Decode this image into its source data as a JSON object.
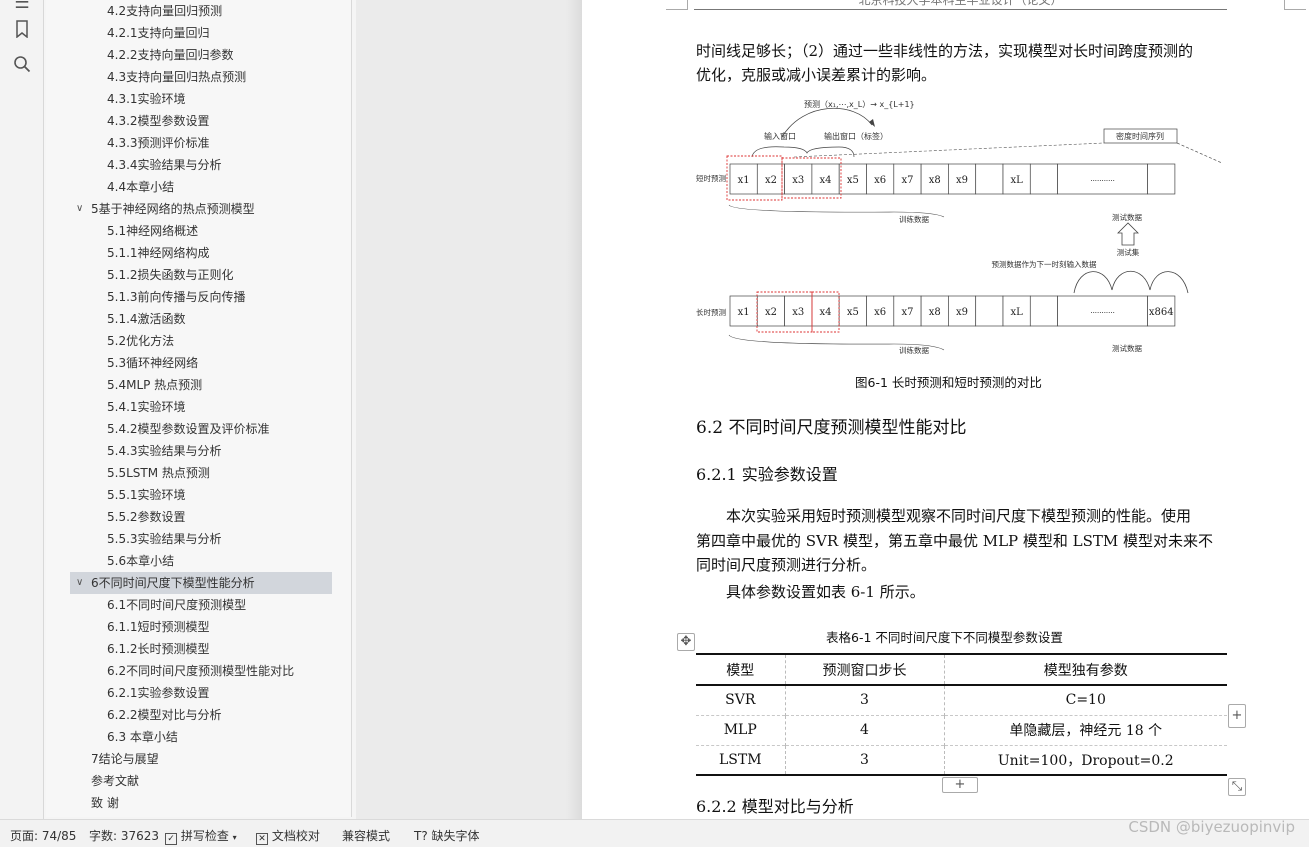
{
  "rail_icons": [
    "list-icon",
    "bookmark-icon",
    "search-icon"
  ],
  "toc": [
    {
      "label": "4.2支持向量回归预测",
      "level": 2
    },
    {
      "label": "4.2.1支持向量回归",
      "level": 2
    },
    {
      "label": "4.2.2支持向量回归参数",
      "level": 2
    },
    {
      "label": "4.3支持向量回归热点预测",
      "level": 2
    },
    {
      "label": "4.3.1实验环境",
      "level": 2
    },
    {
      "label": "4.3.2模型参数设置",
      "level": 2
    },
    {
      "label": "4.3.3预测评价标准",
      "level": 2
    },
    {
      "label": "4.3.4实验结果与分析",
      "level": 2
    },
    {
      "label": "4.4本章小结",
      "level": 2
    },
    {
      "label": "5基于神经网络的热点预测模型",
      "level": 1,
      "expanded": true
    },
    {
      "label": "5.1神经网络概述",
      "level": 2
    },
    {
      "label": "5.1.1神经网络构成",
      "level": 2
    },
    {
      "label": "5.1.2损失函数与正则化",
      "level": 2
    },
    {
      "label": "5.1.3前向传播与反向传播",
      "level": 2
    },
    {
      "label": "5.1.4激活函数",
      "level": 2
    },
    {
      "label": "5.2优化方法",
      "level": 2
    },
    {
      "label": "5.3循环神经网络",
      "level": 2
    },
    {
      "label": "5.4MLP 热点预测",
      "level": 2
    },
    {
      "label": "5.4.1实验环境",
      "level": 2
    },
    {
      "label": "5.4.2模型参数设置及评价标准",
      "level": 2
    },
    {
      "label": "5.4.3实验结果与分析",
      "level": 2
    },
    {
      "label": "5.5LSTM 热点预测",
      "level": 2
    },
    {
      "label": "5.5.1实验环境",
      "level": 2
    },
    {
      "label": "5.5.2参数设置",
      "level": 2
    },
    {
      "label": "5.5.3实验结果与分析",
      "level": 2
    },
    {
      "label": "5.6本章小结",
      "level": 2
    },
    {
      "label": "6不同时间尺度下模型性能分析",
      "level": 1,
      "expanded": true,
      "active": true
    },
    {
      "label": "6.1不同时间尺度预测模型",
      "level": 2
    },
    {
      "label": "6.1.1短时预测模型",
      "level": 2
    },
    {
      "label": "6.1.2长时预测模型",
      "level": 2
    },
    {
      "label": "6.2不同时间尺度预测模型性能对比",
      "level": 2
    },
    {
      "label": "6.2.1实验参数设置",
      "level": 2
    },
    {
      "label": "6.2.2模型对比与分析",
      "level": 2
    },
    {
      "label": "6.3 本章小结",
      "level": 2
    },
    {
      "label": "7结论与展望",
      "level": 1
    },
    {
      "label": "参考文献",
      "level": 1
    },
    {
      "label": "致 谢",
      "level": 1
    }
  ],
  "doc": {
    "header": "北京科技大学本科生毕业设计（论文）",
    "para1_line1": "时间线足够长；（2）通过一些非线性的方法，实现模型对长时间跨度预测的",
    "para1_line2": "优化，克服或减小误差累计的影响。",
    "figure": {
      "predict_formula": "预测（x₁,⋯,x_L）→ x_{L+1}",
      "input_window": "输入窗口",
      "output_window": "输出窗口（标签）",
      "dense_series": "密度时间序列",
      "short_label": "短时预测",
      "long_label": "长时预测",
      "train_data": "训练数据",
      "test_data": "测试数据",
      "test_set": "测试集",
      "feedback": "预测数据作为下一时刻输入数据",
      "cells": [
        "x1",
        "x2",
        "x3",
        "x4",
        "x5",
        "x6",
        "x7",
        "x8",
        "x9",
        "",
        "xL",
        "",
        "···········",
        ""
      ],
      "long_last": "x864",
      "caption": "图6-1 长时预测和短时预测的对比"
    },
    "h_6_2": "6.2 不同时间尺度预测模型性能对比",
    "h_6_2_1": "6.2.1 实验参数设置",
    "para2_line1": "本次实验采用短时预测模型观察不同时间尺度下模型预测的性能。使用",
    "para2_line2": "第四章中最优的 SVR 模型，第五章中最优 MLP 模型和 LSTM 模型对未来不",
    "para2_line3": "同时间尺度预测进行分析。",
    "para3": "具体参数设置如表 6-1 所示。",
    "table_caption": "表格6-1 不同时间尺度下不同模型参数设置",
    "table_headers": [
      "模型",
      "预测窗口步长",
      "模型独有参数"
    ],
    "table_rows": [
      [
        "SVR",
        "3",
        "C=10"
      ],
      [
        "MLP",
        "4",
        "单隐藏层，神经元 18 个"
      ],
      [
        "LSTM",
        "3",
        "Unit=100，Dropout=0.2"
      ]
    ],
    "h_6_2_2": "6.2.2 模型对比与分析"
  },
  "status": {
    "page": "页面: 74/85",
    "words": "字数: 37623",
    "spell": "拼写检查",
    "proofread": "文档校对",
    "compat": "兼容模式",
    "missing_font": "缺失字体"
  },
  "watermark": "CSDN @biyezuopinvip"
}
